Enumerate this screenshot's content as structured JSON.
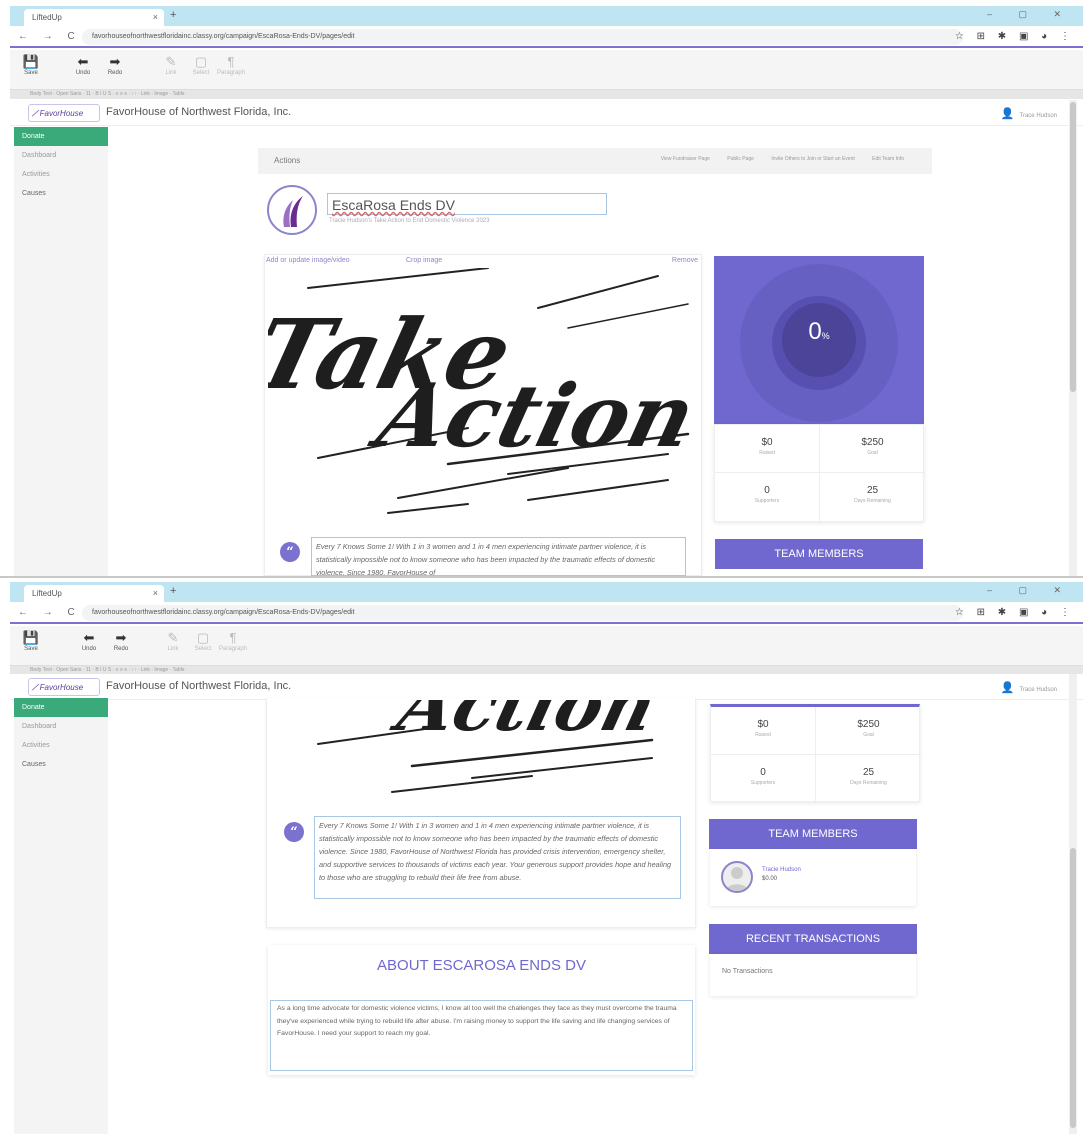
{
  "browser": {
    "tab_title": "LiftedUp",
    "tab_close": "×",
    "new_tab": "+",
    "window_controls": "–  ▢  ✕",
    "nav": "←  →  C",
    "url": "favorhouseofnorthwestfloridainc.classy.org/campaign/EscaRosa-Ends-DV/pages/edit",
    "extensions": "☆  ⊞  ✱  ▣  ◕  ⋮"
  },
  "toolbar": {
    "save_label": "Save",
    "undo_label": "Undo",
    "redo_label": "Redo",
    "link_label": "Link",
    "select_label": "Select",
    "format_label": "Paragraph"
  },
  "format_bar": "Body Text · Open Sans · 11 · B I U S · ≡ ≡ ≡ · ⁝ ⁝ · Link · Image · Table",
  "app": {
    "logo_text": "FavorHouse",
    "org_name": "FavorHouse of Northwest Florida, Inc.",
    "user_name": "Trace Hudson"
  },
  "sidebar": {
    "items": [
      {
        "label": "Donate"
      },
      {
        "label": "Dashboard"
      },
      {
        "label": "Activities"
      },
      {
        "label": "Causes"
      }
    ]
  },
  "actions_bar": {
    "label": "Actions",
    "links": [
      "View Fundraiser Page",
      "Public Page",
      "Invite Others to Join or Start an Event",
      "Edit Team Info"
    ]
  },
  "campaign": {
    "title": "EscaRosa Ends DV",
    "subtitle": "Tracie Hudson's Take Action to End Domestic Violence 2023",
    "image_links": {
      "add": "Add or update image/video",
      "crop": "Crop image",
      "remove": "Remove"
    },
    "image_alt": "Take Action",
    "quote": "Every 7 Knows Some 1! With 1 in 3 women and 1 in 4 men experiencing intimate partner violence, it is statistically impossible not to know someone who has been impacted by the traumatic effects of domestic violence. Since 1980, FavorHouse of Northwest Florida has provided crisis intervention, emergency shelter, and supportive services to thousands of victims each year. Your generous support provides hope and healing to those who are struggling to rebuild their life free from abuse.",
    "quote_short": "Every 7 Knows Some 1! With 1 in 3 women and 1 in 4 men experiencing intimate partner violence, it is statistically impossible not to know someone who has been impacted by the traumatic effects of domestic violence. Since 1980, FavorHouse of"
  },
  "progress": {
    "percent": "0",
    "percent_value": 0,
    "suffix": "%"
  },
  "stats": {
    "raised_value": "$0",
    "raised_label": "Raised",
    "goal_value": "$250",
    "goal_label": "Goal",
    "supporters_value": "0",
    "supporters_label": "Supporters",
    "days_value": "25",
    "days_label": "Days Remaining"
  },
  "team": {
    "header": "TEAM MEMBERS",
    "member_name": "Tracie Hudson",
    "member_amount": "$0.00"
  },
  "transactions": {
    "header": "RECENT TRANSACTIONS",
    "empty": "No Transactions"
  },
  "about": {
    "title": "ABOUT ESCAROSA ENDS DV",
    "text": "As a long time advocate for domestic violence victims, I know all too well the challenges they face as they must overcome the trauma they've experienced while trying to rebuild life after abuse. I'm raising money to support the life saving and life changing services of FavorHouse. I need your support to reach my goal."
  },
  "colors": {
    "accent": "#7068cf",
    "sidebar_active": "#3aaa7a",
    "chrome_tab": "#bfe4f2"
  }
}
